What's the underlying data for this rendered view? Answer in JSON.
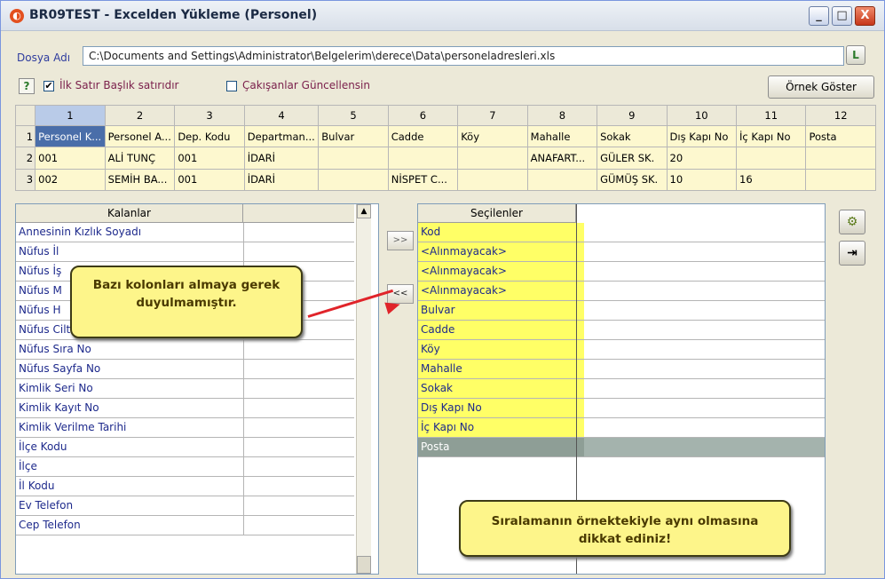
{
  "window": {
    "title": "BR09TEST - Excelden Yükleme (Personel)",
    "minimize": "_",
    "maximize": "□",
    "close": "X"
  },
  "file": {
    "label": "Dosya Adı",
    "path": "C:\\Documents and Settings\\Administrator\\Belgelerim\\derece\\Data\\personeladresleri.xls",
    "browse_icon": "L"
  },
  "options": {
    "help": "?",
    "first_row_header": {
      "label": "İlk Satır Başlık satırıdır",
      "checked": true,
      "mark": "✔"
    },
    "update_conflicts": {
      "label": "Çakışanlar Güncellensin",
      "checked": false,
      "mark": ""
    },
    "example_button": "Örnek Göster"
  },
  "grid": {
    "columns": [
      "1",
      "2",
      "3",
      "4",
      "5",
      "6",
      "7",
      "8",
      "9",
      "10",
      "11",
      "12"
    ],
    "rows": [
      {
        "num": "1",
        "cells": [
          "Personel K...",
          "Personel A...",
          "Dep. Kodu",
          "Departman...",
          "Bulvar",
          "Cadde",
          "Köy",
          "Mahalle",
          "Sokak",
          "Dış Kapı No",
          "İç Kapı No",
          "Posta"
        ]
      },
      {
        "num": "2",
        "cells": [
          "001",
          "ALİ TUNÇ",
          "001",
          "İDARİ",
          "",
          "",
          "",
          "ANAFART...",
          "GÜLER SK.",
          "20",
          "",
          ""
        ]
      },
      {
        "num": "3",
        "cells": [
          "002",
          "SEMİH BA...",
          "001",
          "İDARİ",
          "",
          "NİSPET C...",
          "",
          "",
          "GÜMÜŞ SK.",
          "10",
          "16",
          ""
        ]
      }
    ]
  },
  "remaining": {
    "header": "Kalanlar",
    "items": [
      "Annesinin Kızlık Soyadı",
      "Nüfus İl",
      "Nüfus İş",
      "Nüfus M",
      "Nüfus H",
      "Nüfus Cilt No",
      "Nüfus Sıra No",
      "Nüfus Sayfa No",
      "Kimlik Seri No",
      "Kimlik Kayıt No",
      "Kimlik Verilme Tarihi",
      "İlçe Kodu",
      "İlçe",
      "İl Kodu",
      "Ev Telefon",
      "Cep Telefon"
    ]
  },
  "move_buttons": {
    "add": ">>",
    "remove": "<<"
  },
  "selected": {
    "header": "Seçilenler",
    "items": [
      "Kod",
      "<Alınmayacak>",
      "<Alınmayacak>",
      "<Alınmayacak>",
      "Bulvar",
      "Cadde",
      "Köy",
      "Mahalle",
      "Sokak",
      "Dış Kapı No",
      "İç Kapı No",
      "Posta"
    ]
  },
  "side_buttons": {
    "run_icon": "⚙",
    "exit_icon": "⇥"
  },
  "callouts": {
    "left": "Bazı kolonları almaya gerek duyulmamıştır.",
    "right": "Sıralamanın örnektekiyle aynı olmasına dikkat ediniz!"
  },
  "colors": {
    "highlight": "#ffff66",
    "selected_row": "#8e9e96",
    "arrow": "#e0242a",
    "callout_bg": "#fdf58a"
  }
}
